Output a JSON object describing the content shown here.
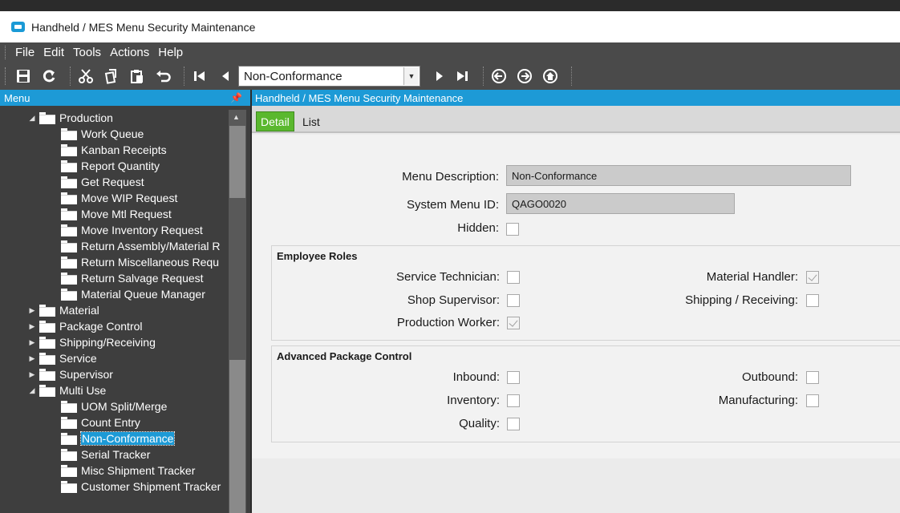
{
  "window": {
    "title": "Handheld / MES Menu Security Maintenance"
  },
  "menu": [
    "File",
    "Edit",
    "Tools",
    "Actions",
    "Help"
  ],
  "toolbar": {
    "nav_value": "Non-Conformance"
  },
  "left_panel": {
    "header": "Menu",
    "tree": [
      {
        "label": "Production",
        "level": 0,
        "expanded": true
      },
      {
        "label": "Work Queue",
        "level": 1
      },
      {
        "label": "Kanban Receipts",
        "level": 1
      },
      {
        "label": "Report Quantity",
        "level": 1
      },
      {
        "label": "Get Request",
        "level": 1
      },
      {
        "label": "Move WIP Request",
        "level": 1
      },
      {
        "label": "Move Mtl Request",
        "level": 1
      },
      {
        "label": "Move Inventory Request",
        "level": 1
      },
      {
        "label": "Return Assembly/Material R",
        "level": 1
      },
      {
        "label": "Return Miscellaneous Requ",
        "level": 1
      },
      {
        "label": "Return Salvage Request",
        "level": 1
      },
      {
        "label": "Material Queue Manager",
        "level": 1
      },
      {
        "label": "Material",
        "level": 0,
        "expanded": false
      },
      {
        "label": "Package Control",
        "level": 0,
        "expanded": false
      },
      {
        "label": "Shipping/Receiving",
        "level": 0,
        "expanded": false
      },
      {
        "label": "Service",
        "level": 0,
        "expanded": false
      },
      {
        "label": "Supervisor",
        "level": 0,
        "expanded": false
      },
      {
        "label": "Multi Use",
        "level": 0,
        "expanded": true
      },
      {
        "label": "UOM Split/Merge",
        "level": 1
      },
      {
        "label": "Count Entry",
        "level": 1
      },
      {
        "label": "Non-Conformance",
        "level": 1,
        "selected": true
      },
      {
        "label": "Serial Tracker",
        "level": 1
      },
      {
        "label": "Misc Shipment Tracker",
        "level": 1
      },
      {
        "label": "Customer Shipment Tracker",
        "level": 1
      }
    ]
  },
  "main": {
    "header": "Handheld / MES Menu Security Maintenance",
    "tabs": {
      "detail": "Detail",
      "list": "List"
    },
    "fields": {
      "menu_description_label": "Menu Description:",
      "menu_description_value": "Non-Conformance",
      "system_menu_id_label": "System Menu ID:",
      "system_menu_id_value": "QAGO0020",
      "hidden_label": "Hidden:"
    },
    "employee_roles": {
      "title": "Employee Roles",
      "service_technician": "Service Technician:",
      "shop_supervisor": "Shop Supervisor:",
      "production_worker": "Production Worker:",
      "material_handler": "Material Handler:",
      "shipping_receiving": "Shipping / Receiving:"
    },
    "advanced_package_control": {
      "title": "Advanced Package Control",
      "inbound": "Inbound:",
      "inventory": "Inventory:",
      "quality": "Quality:",
      "outbound": "Outbound:",
      "manufacturing": "Manufacturing:"
    }
  }
}
